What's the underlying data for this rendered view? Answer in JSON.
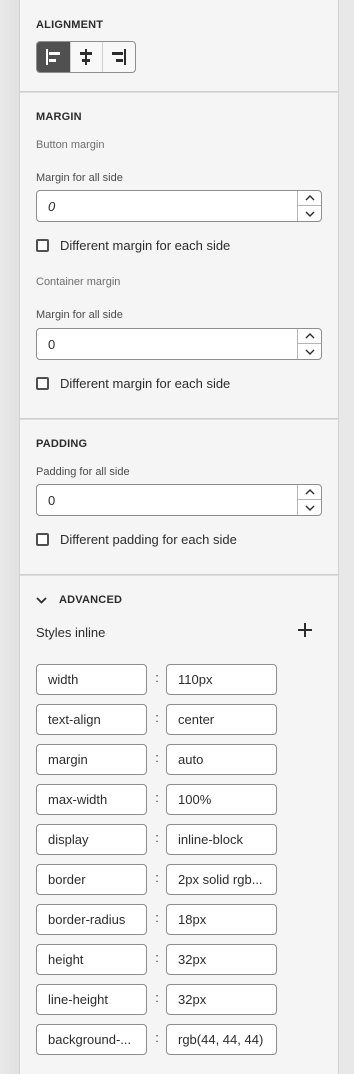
{
  "alignment": {
    "title": "ALIGNMENT",
    "buttons": [
      {
        "name": "align-left",
        "active": true
      },
      {
        "name": "align-center",
        "active": false
      },
      {
        "name": "align-right",
        "active": false
      }
    ]
  },
  "margin": {
    "title": "MARGIN",
    "button_margin": {
      "sublabel": "Button margin",
      "field_label": "Margin for all side",
      "value": "0",
      "checkbox_label": "Different margin for each side"
    },
    "container_margin": {
      "sublabel": "Container margin",
      "field_label": "Margin for all side",
      "value": "0",
      "checkbox_label": "Different margin for each side"
    }
  },
  "padding": {
    "title": "PADDING",
    "field_label": "Padding for all side",
    "value": "0",
    "checkbox_label": "Different padding for each side"
  },
  "advanced": {
    "title": "ADVANCED",
    "styles_label": "Styles inline",
    "separator": ":",
    "styles": [
      {
        "key": "width",
        "value": "110px"
      },
      {
        "key": "text-align",
        "value": "center"
      },
      {
        "key": "margin",
        "value": "auto"
      },
      {
        "key": "max-width",
        "value": "100%"
      },
      {
        "key": "display",
        "value": "inline-block"
      },
      {
        "key": "border",
        "value": "2px solid rgb..."
      },
      {
        "key": "border-radius",
        "value": "18px"
      },
      {
        "key": "height",
        "value": "32px"
      },
      {
        "key": "line-height",
        "value": "32px"
      },
      {
        "key": "background-...",
        "value": "rgb(44, 44, 44)"
      }
    ]
  },
  "colors": {
    "panel_bg": "#f5f5f5",
    "active_button": "#505050",
    "text": "#2c2c2c"
  }
}
